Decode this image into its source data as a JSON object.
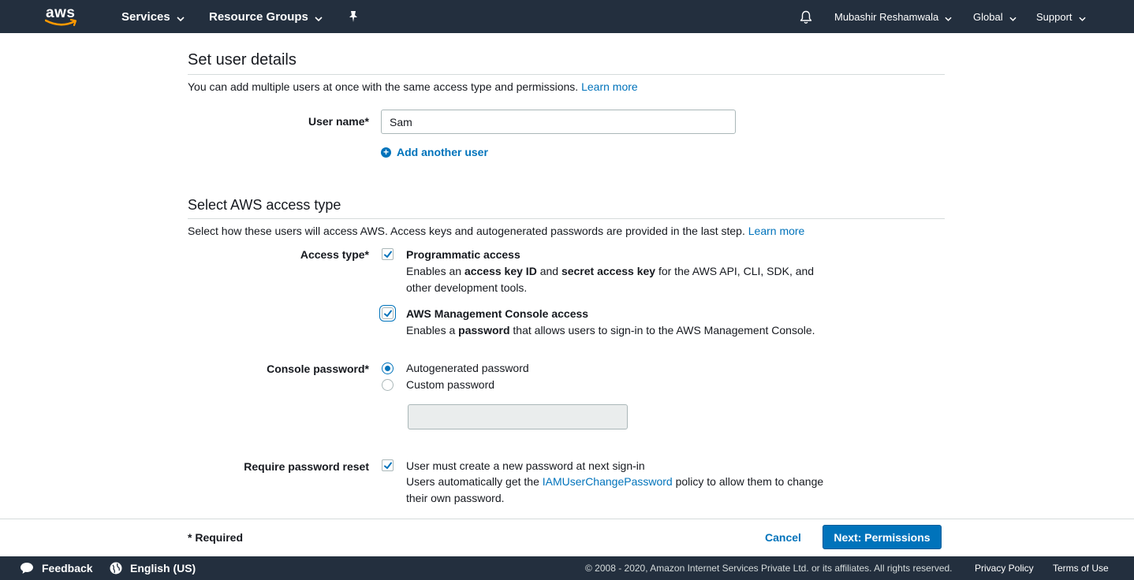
{
  "nav": {
    "logo_text": "aws",
    "services": "Services",
    "resource_groups": "Resource Groups",
    "user": "Mubashir Reshamwala",
    "region": "Global",
    "support": "Support"
  },
  "user_details": {
    "title": "Set user details",
    "description": "You can add multiple users at once with the same access type and permissions.",
    "learn_more": "Learn more",
    "username_label": "User name*",
    "username_value": "Sam",
    "add_another": "Add another user"
  },
  "access_type": {
    "title": "Select AWS access type",
    "description": "Select how these users will access AWS. Access keys and autogenerated passwords are provided in the last step.",
    "learn_more": "Learn more",
    "label": "Access type*",
    "programmatic": {
      "title": "Programmatic access",
      "desc_1": "Enables an ",
      "desc_bold_1": "access key ID",
      "desc_2": " and ",
      "desc_bold_2": "secret access key",
      "desc_3": " for the AWS API, CLI, SDK, and",
      "desc_4": "other development tools.",
      "checked": true
    },
    "console": {
      "title": "AWS Management Console access",
      "desc_1": "Enables a ",
      "desc_bold": "password",
      "desc_2": " that allows users to sign-in to the AWS Management Console.",
      "checked": true
    }
  },
  "console_password": {
    "label": "Console password*",
    "autogenerated": "Autogenerated password",
    "custom": "Custom password",
    "selected": "autogenerated"
  },
  "password_reset": {
    "label": "Require password reset",
    "checkbox_label": "User must create a new password at next sign-in",
    "desc_1": "Users automatically get the ",
    "policy_link": "IAMUserChangePassword",
    "desc_2": " policy to allow them to change",
    "desc_3": "their own password.",
    "checked": true
  },
  "actions": {
    "required_note": "* Required",
    "cancel": "Cancel",
    "next": "Next: Permissions"
  },
  "footer": {
    "feedback": "Feedback",
    "language": "English (US)",
    "copyright": "© 2008 - 2020, Amazon Internet Services Private Ltd. or its affiliates. All rights reserved.",
    "privacy": "Privacy Policy",
    "terms": "Terms of Use"
  },
  "colors": {
    "nav_bg": "#232f3e",
    "accent": "#0073bb",
    "logo_smile": "#ff9900"
  },
  "icons": [
    "aws-logo-icon",
    "chevron-down-icon",
    "pin-icon",
    "bell-icon",
    "plus-circle-icon",
    "checkmark-icon",
    "speech-bubble-icon",
    "globe-icon"
  ]
}
